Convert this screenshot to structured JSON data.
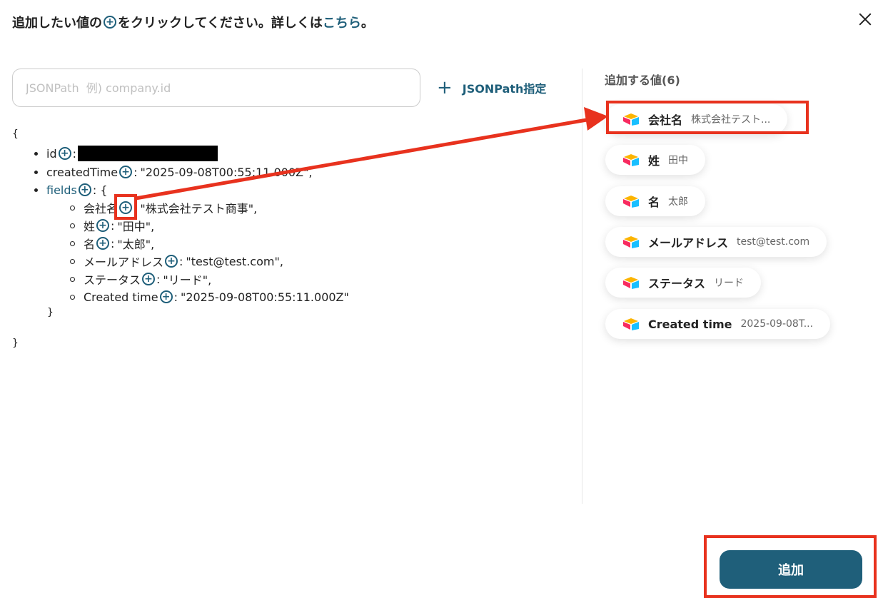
{
  "header": {
    "title_prefix": "追加したい値の",
    "title_middle": "をクリックしてください。詳しくは",
    "title_link": "こちら",
    "title_suffix": "。"
  },
  "search": {
    "placeholder": "JSONPath  例) company.id",
    "value": ""
  },
  "jsonpath_button": {
    "label": "JSONPath指定"
  },
  "json_tree": {
    "open_brace": "{",
    "close_brace": "}",
    "inner_close": "}",
    "rows": [
      {
        "key": "id",
        "sep": ":",
        "value": ""
      },
      {
        "key": "createdTime",
        "sep": ":",
        "value": "\"2025-09-08T00:55:11.000Z\","
      },
      {
        "key": "fields",
        "sep": ": {",
        "value": ""
      }
    ],
    "field_rows": [
      {
        "key": "会社名",
        "sep": ":",
        "value": "\"株式会社テスト商事\","
      },
      {
        "key": "姓",
        "sep": ":",
        "value": "\"田中\","
      },
      {
        "key": "名",
        "sep": ":",
        "value": "\"太郎\","
      },
      {
        "key": "メールアドレス",
        "sep": ":",
        "value": "\"test@test.com\","
      },
      {
        "key": "ステータス",
        "sep": ":",
        "value": "\"リード\","
      },
      {
        "key": "Created time",
        "sep": ":",
        "value": "\"2025-09-08T00:55:11.000Z\""
      }
    ]
  },
  "right_panel": {
    "heading": "追加する値(6)",
    "chips": [
      {
        "label": "会社名",
        "value": "株式会社テスト..."
      },
      {
        "label": "姓",
        "value": "田中"
      },
      {
        "label": "名",
        "value": "太郎"
      },
      {
        "label": "メールアドレス",
        "value": "test@test.com"
      },
      {
        "label": "ステータス",
        "value": "リード"
      },
      {
        "label": "Created time",
        "value": "2025-09-08T..."
      }
    ]
  },
  "footer": {
    "add_label": "追加"
  },
  "colors": {
    "accent": "#1f5f7a",
    "highlight": "#e8321e"
  },
  "icons": {
    "close": "close-icon",
    "plus": "plus-circle-icon",
    "chip": "airtable-logo-icon"
  }
}
